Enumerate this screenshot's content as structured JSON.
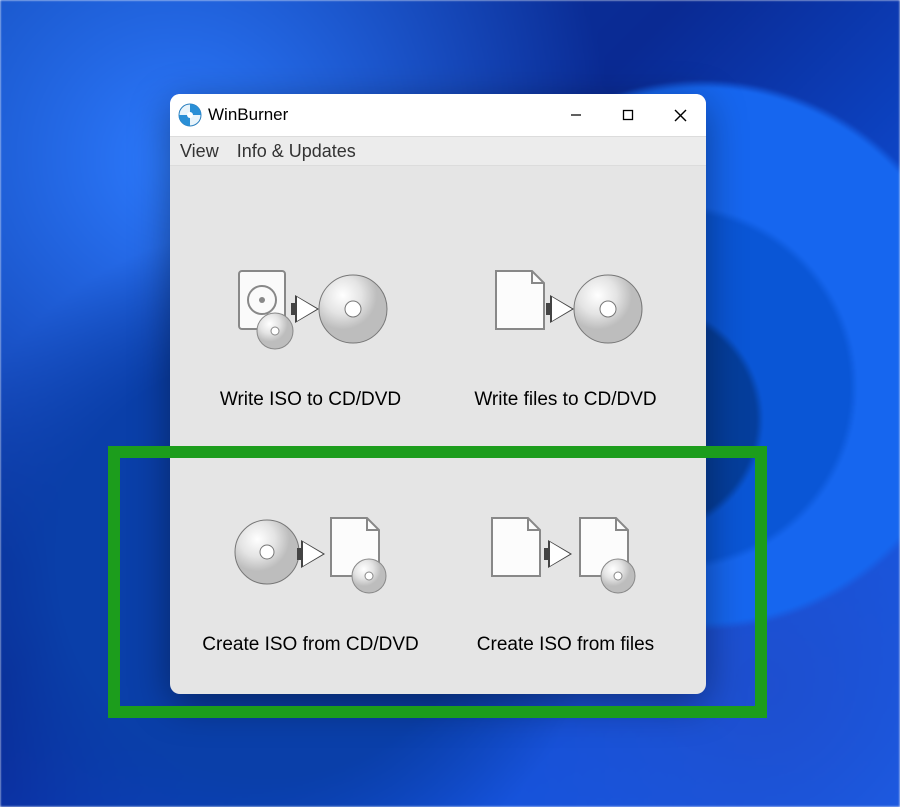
{
  "app": {
    "title": "WinBurner"
  },
  "menubar": {
    "view": "View",
    "info": "Info & Updates"
  },
  "actions": {
    "writeIso": "Write ISO to CD/DVD",
    "writeFiles": "Write files to CD/DVD",
    "createIsoCd": "Create ISO from CD/DVD",
    "createIsoFiles": "Create ISO from files"
  }
}
